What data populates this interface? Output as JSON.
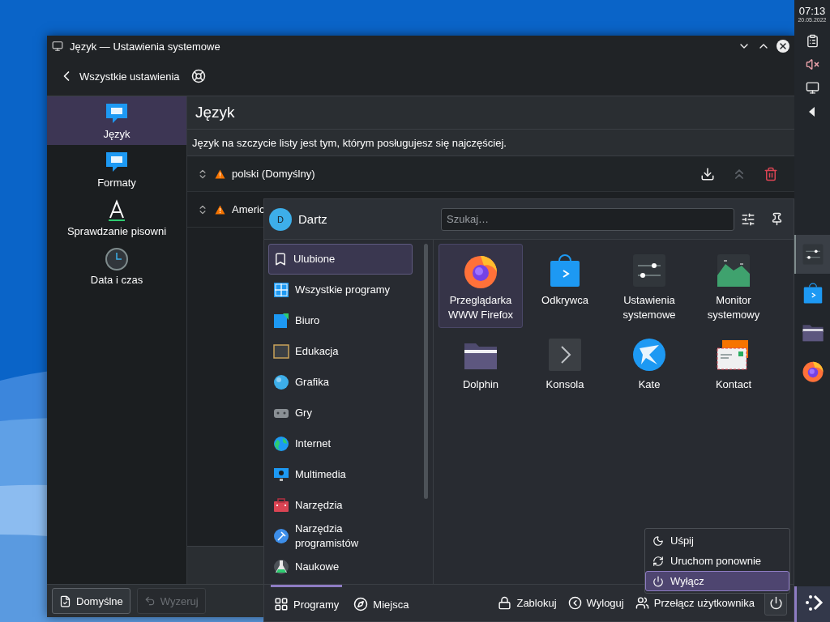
{
  "panel": {
    "time": "07:13",
    "date": "20.05.2022",
    "tasks": [
      {
        "kind": "settings",
        "selected": true
      },
      {
        "kind": "discover",
        "selected": false
      },
      {
        "kind": "folder",
        "selected": false
      },
      {
        "kind": "firefox",
        "selected": false
      }
    ]
  },
  "window": {
    "title": "Język — Ustawienia systemowe",
    "back_label": "Wszystkie ustawienia",
    "sidebar": [
      {
        "label": "Język",
        "kind": "chat",
        "selected": true
      },
      {
        "label": "Formaty",
        "kind": "chat",
        "selected": false
      },
      {
        "label": "Sprawdzanie pisowni",
        "kind": "letter",
        "selected": false
      },
      {
        "label": "Data i czas",
        "kind": "clock",
        "selected": false
      }
    ],
    "page_title": "Język",
    "description": "Język na szczycie listy jest tym, którym posługujesz się najczęściej.",
    "languages": [
      {
        "name": "polski (Domyślny)",
        "warning": true,
        "hovered": true
      },
      {
        "name": "Americ",
        "warning": true,
        "hovered": false
      }
    ],
    "buttons": [
      {
        "label": "Domyślne",
        "kind": "defaults",
        "disabled": false
      },
      {
        "label": "Wyzeruj",
        "kind": "reset",
        "disabled": true
      }
    ]
  },
  "launcher": {
    "avatar": "D",
    "user": "Dartz",
    "search": {
      "placeholder": "Szukaj…"
    },
    "categories": [
      {
        "label": "Ulubione",
        "kind": "favorites",
        "selected": true
      },
      {
        "label": "Wszystkie programy",
        "kind": "all",
        "selected": false
      },
      {
        "label": "Biuro",
        "kind": "office",
        "selected": false
      },
      {
        "label": "Edukacja",
        "kind": "education",
        "selected": false
      },
      {
        "label": "Grafika",
        "kind": "graphics",
        "selected": false
      },
      {
        "label": "Gry",
        "kind": "games",
        "selected": false
      },
      {
        "label": "Internet",
        "kind": "internet",
        "selected": false
      },
      {
        "label": "Multimedia",
        "kind": "multimedia",
        "selected": false
      },
      {
        "label": "Narzędzia",
        "kind": "utilities",
        "selected": false
      },
      {
        "label": "Narzędzia programistów",
        "kind": "development",
        "selected": false
      },
      {
        "label": "Naukowe",
        "kind": "science",
        "selected": false
      }
    ],
    "apps": [
      {
        "label": "Przeglądarka WWW Firefox",
        "kind": "firefox",
        "selected": true
      },
      {
        "label": "Odkrywca",
        "kind": "discover",
        "selected": false
      },
      {
        "label": "Ustawienia systemowe",
        "kind": "settings",
        "selected": false
      },
      {
        "label": "Monitor systemowy",
        "kind": "monitor",
        "selected": false
      },
      {
        "label": "Dolphin",
        "kind": "folder",
        "selected": false
      },
      {
        "label": "Konsola",
        "kind": "terminal",
        "selected": false
      },
      {
        "label": "Kate",
        "kind": "kate",
        "selected": false
      },
      {
        "label": "Kontact",
        "kind": "mail",
        "selected": false
      }
    ],
    "tabs": [
      {
        "label": "Programy",
        "kind": "grid",
        "selected": true
      },
      {
        "label": "Miejsca",
        "kind": "compass",
        "selected": false
      }
    ],
    "actions": [
      {
        "label": "Zablokuj",
        "kind": "lock"
      },
      {
        "label": "Wyloguj",
        "kind": "logout"
      },
      {
        "label": "Przełącz użytkownika",
        "kind": "users"
      }
    ],
    "power_menu": [
      {
        "label": "Uśpij",
        "kind": "sleep",
        "selected": false
      },
      {
        "label": "Uruchom ponownie",
        "kind": "restart",
        "selected": false
      },
      {
        "label": "Wyłącz",
        "kind": "shutdown",
        "selected": true
      }
    ]
  }
}
